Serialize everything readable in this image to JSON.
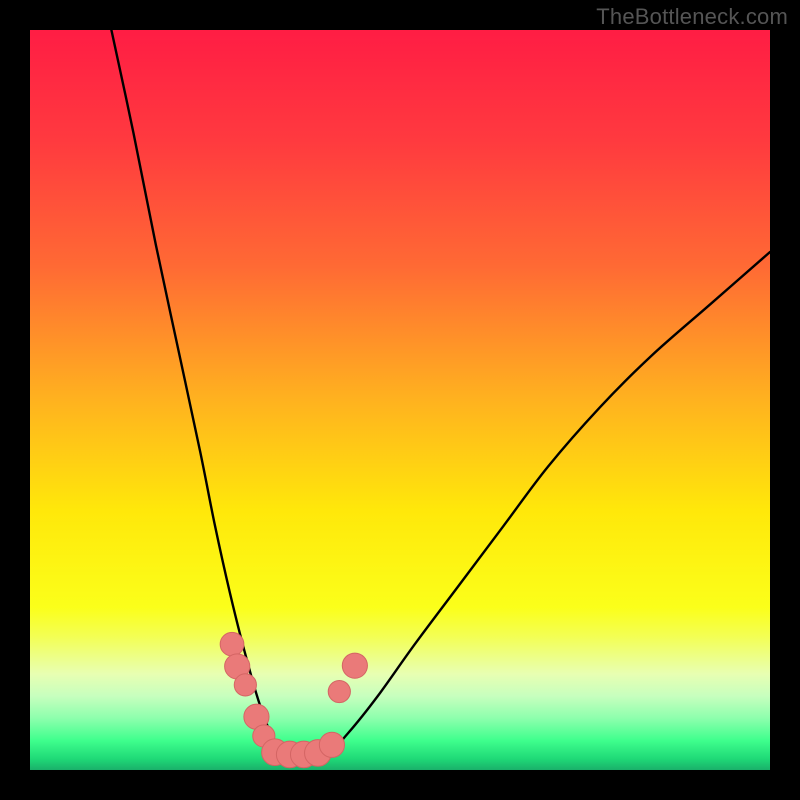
{
  "watermark": "TheBottleneck.com",
  "colors": {
    "background": "#000000",
    "curve": "#000000",
    "dot_fill": "#ea7a79",
    "dot_stroke": "#d46564",
    "gradient_stops": [
      {
        "offset": 0.0,
        "color": "#ff1d44"
      },
      {
        "offset": 0.15,
        "color": "#ff3a3f"
      },
      {
        "offset": 0.32,
        "color": "#ff6a34"
      },
      {
        "offset": 0.5,
        "color": "#ffb21f"
      },
      {
        "offset": 0.65,
        "color": "#ffe80a"
      },
      {
        "offset": 0.78,
        "color": "#fbff1a"
      },
      {
        "offset": 0.82,
        "color": "#f3ff55"
      },
      {
        "offset": 0.87,
        "color": "#e8ffb2"
      },
      {
        "offset": 0.9,
        "color": "#c7ffbe"
      },
      {
        "offset": 0.93,
        "color": "#8dffad"
      },
      {
        "offset": 0.96,
        "color": "#3fff8d"
      },
      {
        "offset": 0.985,
        "color": "#1fd977"
      },
      {
        "offset": 1.0,
        "color": "#1ab06a"
      }
    ]
  },
  "chart_data": {
    "type": "line",
    "title": "",
    "xlabel": "",
    "ylabel": "",
    "xlim": [
      0,
      100
    ],
    "ylim": [
      0,
      100
    ],
    "grid": false,
    "legend": false,
    "description": "Bottleneck-style V curve: left arm steep, right arm shallower. Values are percent of full scale (0=bottom/left, 100=top/right). Curve minimum on the valley floor ~x 31–40 at y≈2. Salmon dots mark the lower portion of both arms and a small flat cluster at the bottom.",
    "series": [
      {
        "name": "curve",
        "x": [
          11,
          14,
          17,
          20,
          23,
          25,
          27,
          29,
          31,
          33,
          35,
          37,
          40,
          43,
          47,
          52,
          58,
          64,
          70,
          77,
          84,
          92,
          100
        ],
        "y": [
          100,
          86,
          71,
          57,
          43,
          33,
          24,
          16,
          9,
          4,
          2,
          2,
          2,
          5,
          10,
          17,
          25,
          33,
          41,
          49,
          56,
          63,
          70
        ]
      }
    ],
    "dots": [
      {
        "x": 27.3,
        "y": 17.0,
        "r": 1.6
      },
      {
        "x": 28.0,
        "y": 14.0,
        "r": 1.7
      },
      {
        "x": 29.1,
        "y": 11.5,
        "r": 1.5
      },
      {
        "x": 30.6,
        "y": 7.2,
        "r": 1.7
      },
      {
        "x": 31.6,
        "y": 4.6,
        "r": 1.5
      },
      {
        "x": 33.1,
        "y": 2.4,
        "r": 1.8
      },
      {
        "x": 35.1,
        "y": 2.1,
        "r": 1.8
      },
      {
        "x": 37.0,
        "y": 2.1,
        "r": 1.8
      },
      {
        "x": 38.9,
        "y": 2.3,
        "r": 1.8
      },
      {
        "x": 40.8,
        "y": 3.4,
        "r": 1.7
      },
      {
        "x": 41.8,
        "y": 10.6,
        "r": 1.5
      },
      {
        "x": 43.9,
        "y": 14.1,
        "r": 1.7
      }
    ]
  }
}
